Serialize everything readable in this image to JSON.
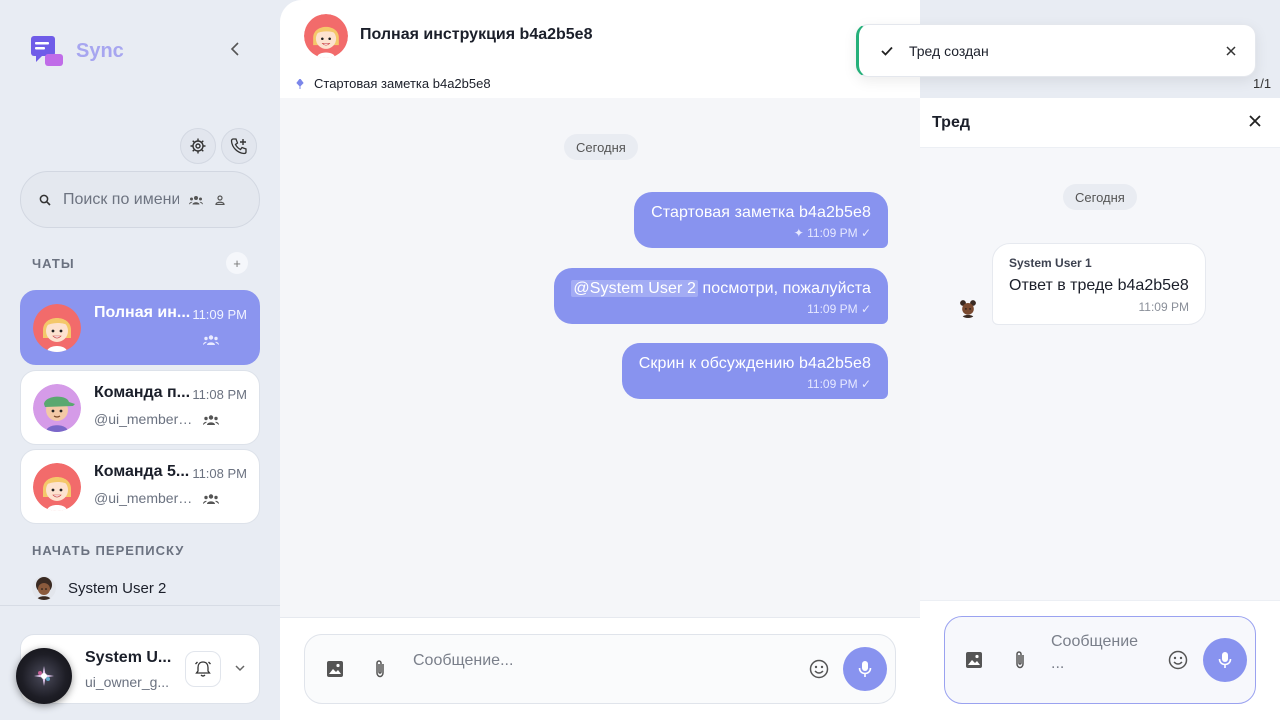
{
  "app": {
    "name": "Sync",
    "brand_color": "#8893ef"
  },
  "sidebar": {
    "search_placeholder": "Поиск по имени",
    "chats_section": "ЧАТЫ",
    "chats": [
      {
        "name": "Полная ин...",
        "time": "11:09 PM",
        "subtitle": "",
        "active": true
      },
      {
        "name": "Команда п...",
        "time": "11:08 PM",
        "subtitle": "@ui_member_...",
        "active": false
      },
      {
        "name": "Команда 5...",
        "time": "11:08 PM",
        "subtitle": "@ui_member_...",
        "active": false
      }
    ],
    "start_section": "НАЧАТЬ ПЕРЕПИСКУ",
    "start_users": [
      {
        "name": "System User 2"
      }
    ],
    "profile": {
      "name": "System U...",
      "username": "ui_owner_g..."
    }
  },
  "chat": {
    "title": "Полная инструкция b4a2b5e8",
    "pinned": "Стартовая заметка b4a2b5e8",
    "date_chip": "Сегодня",
    "messages": [
      {
        "text": "Стартовая заметка b4a2b5e8",
        "time": "11:09 PM"
      },
      {
        "mention": "@System User 2",
        "text": " посмотри, пожалуйста",
        "time": "11:09 PM"
      },
      {
        "text": "Скрин к обсуждению b4a2b5e8",
        "time": "11:09 PM"
      }
    ],
    "composer_placeholder": "Сообщение..."
  },
  "thread": {
    "title": "Тред",
    "counter": "1/1",
    "date_chip": "Сегодня",
    "message": {
      "author": "System User 1",
      "text": "Ответ в треде b4a2b5e8",
      "time": "11:09 PM"
    },
    "composer_placeholder": "Сообщение ..."
  },
  "toast": {
    "text": "Тред создан",
    "status_color": "#25b07a"
  }
}
